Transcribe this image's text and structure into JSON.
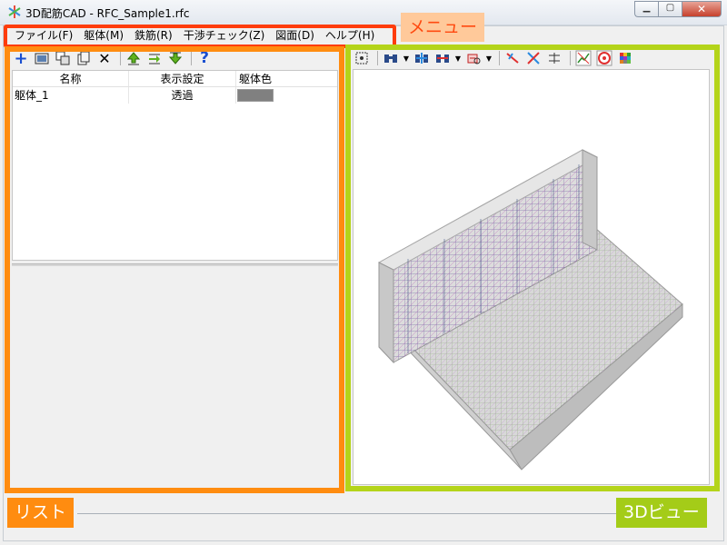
{
  "window": {
    "title": "3D配筋CAD - RFC_Sample1.rfc",
    "min_glyph": "▁",
    "max_glyph": "▢",
    "close_glyph": "✕"
  },
  "menu": {
    "items": [
      "ファイル(F)",
      "躯体(M)",
      "鉄筋(R)",
      "干渉チェック(Z)",
      "図面(D)",
      "ヘルプ(H)"
    ]
  },
  "left_toolbar": {
    "icons": [
      "add-icon",
      "folder-image-icon",
      "copy-settings-icon",
      "duplicate-icon",
      "delete-icon",
      "move-up-icon",
      "move-to-icon",
      "move-down-icon",
      "help-icon"
    ],
    "help_glyph": "?",
    "add_glyph": "+",
    "delete_glyph": "✕"
  },
  "list": {
    "headers": [
      "名称",
      "表示設定",
      "躯体色"
    ],
    "rows": [
      {
        "name": "躯体_1",
        "display": "透過",
        "color": "#808080"
      }
    ]
  },
  "view_toolbar": {
    "icons": [
      "fit-view-icon",
      "binoculars-icon",
      "zoom-in-icon",
      "zoom-out-icon",
      "rotate-view-icon",
      "axis-x-icon",
      "axis-cross-icon",
      "dimension-icon",
      "graph-icon",
      "target-icon",
      "color-grid-icon"
    ]
  },
  "annotations": {
    "menu_label": "メニュー",
    "list_label": "リスト",
    "view_label": "3Dビュー"
  },
  "colors": {
    "menu_highlight": "#ff3c0c",
    "list_highlight": "#ff8c10",
    "view_highlight": "#b4d41a"
  }
}
